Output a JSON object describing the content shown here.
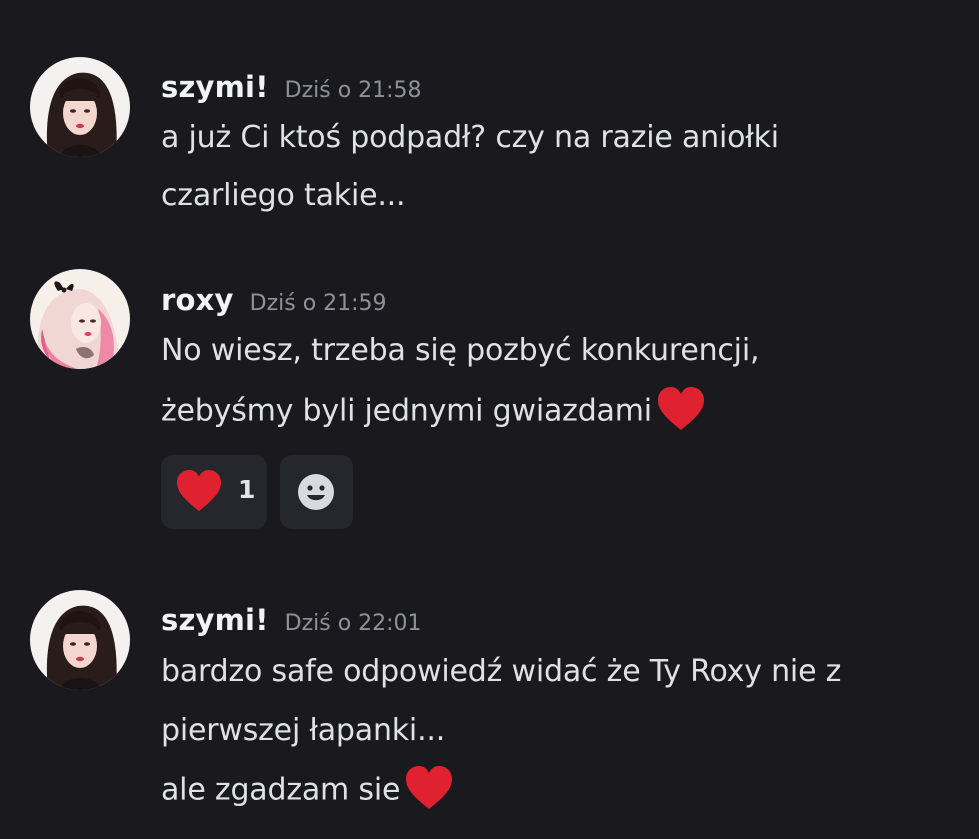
{
  "messages": [
    {
      "username": "szymi!",
      "timestamp": "Dziś o 21:58",
      "lines": [
        "a już Ci ktoś podpadł? czy na razie aniołki",
        "czarliego takie..."
      ]
    },
    {
      "username": "roxy",
      "timestamp": "Dziś o 21:59",
      "lines": [
        "No wiesz, trzeba się pozbyć konkurencji,",
        "żebyśmy byli jednymi gwiazdami"
      ],
      "reactions": [
        {
          "emoji": "heart",
          "count": "1"
        }
      ]
    },
    {
      "username": "szymi!",
      "timestamp": "Dziś o 22:01",
      "lines": [
        "bardzo safe odpowiedź widać że Ty Roxy nie z",
        "pierwszej łapanki...",
        "ale zgadzam sie"
      ]
    }
  ],
  "colors": {
    "background": "#1a1a1e",
    "heart": "#e0212f",
    "reaction_bg": "#26272c",
    "timestamp": "#8e9199"
  },
  "icons": {
    "inline_emoji": "heart-emoji-icon",
    "add_reaction": "add-reaction-smiley-icon"
  }
}
